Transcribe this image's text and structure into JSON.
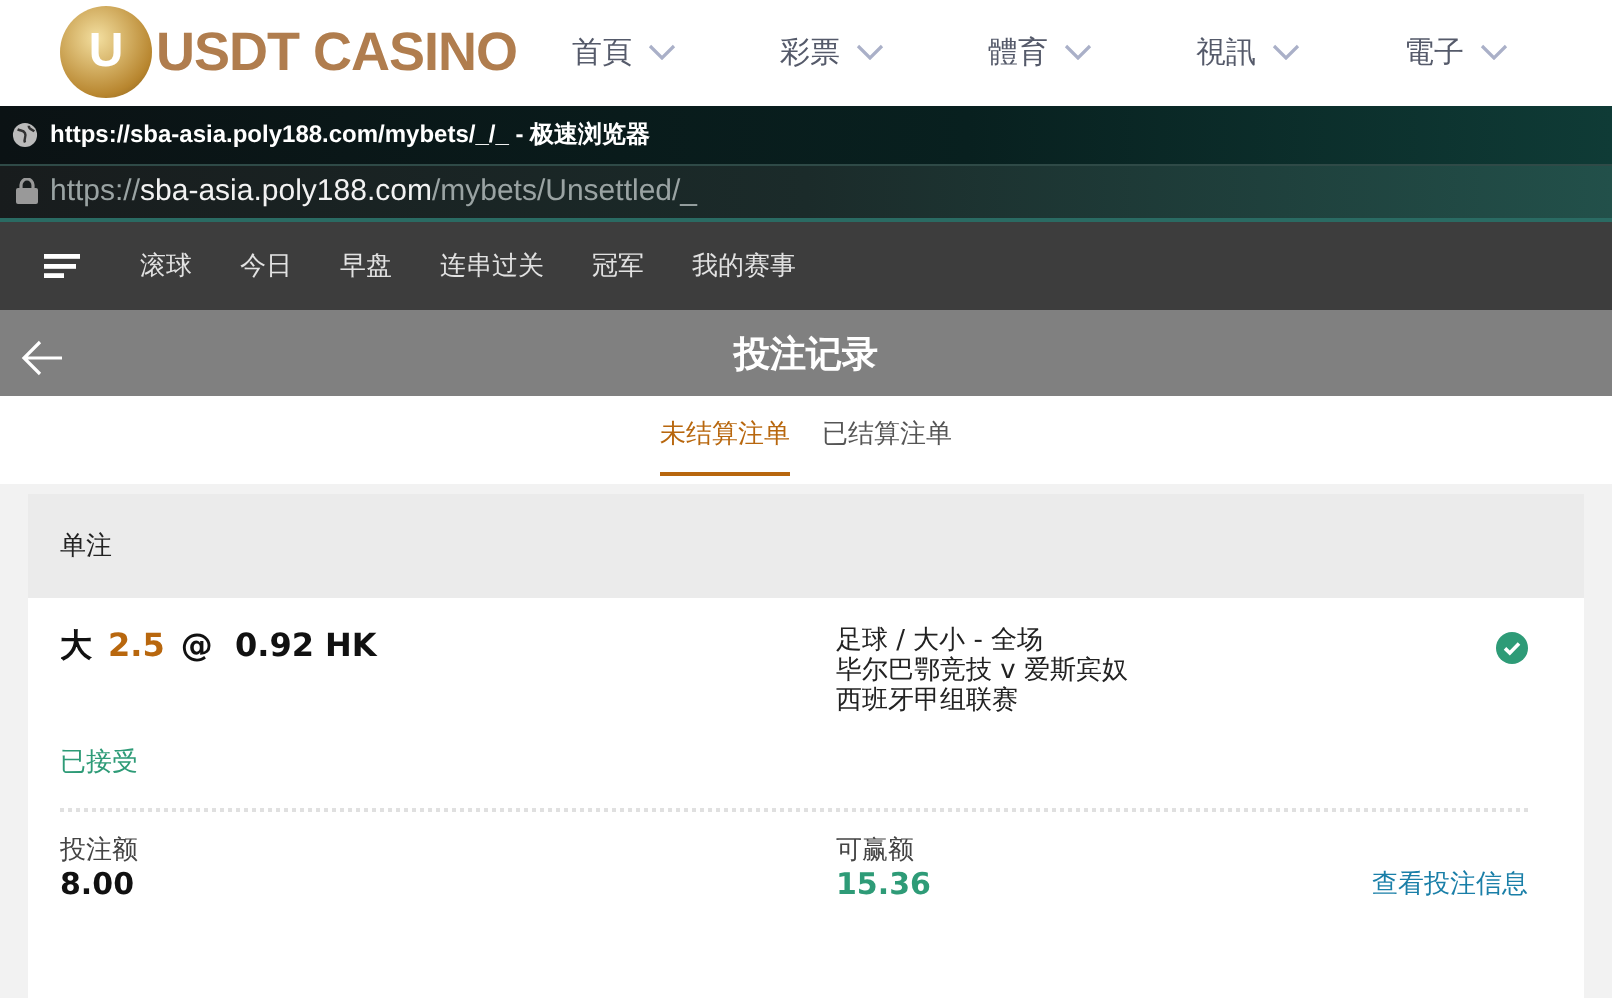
{
  "site_header": {
    "logo_mark": "U",
    "logo_text": "USDT CASINO",
    "menu": [
      {
        "label": "首頁"
      },
      {
        "label": "彩票"
      },
      {
        "label": "體育"
      },
      {
        "label": "視訊"
      },
      {
        "label": "電子"
      }
    ]
  },
  "browser": {
    "title": "https://sba-asia.poly188.com/mybets/_/_ - 极速浏览器",
    "address": {
      "scheme": "https://",
      "host": "sba-asia.poly188.com",
      "path": "/mybets/Unsettled/_"
    }
  },
  "sport_nav": {
    "items": [
      {
        "label": "滚球"
      },
      {
        "label": "今日"
      },
      {
        "label": "早盘"
      },
      {
        "label": "连串过关"
      },
      {
        "label": "冠军"
      },
      {
        "label": "我的赛事"
      }
    ]
  },
  "page_title": "投注记录",
  "tabs": [
    {
      "label": "未结算注单",
      "selected": true
    },
    {
      "label": "已结算注单",
      "selected": false
    }
  ],
  "bet_card": {
    "header": "单注",
    "selection": "大",
    "line": "2.5",
    "odds": "@  0.92 HK",
    "market": "足球 / 大小 - 全场",
    "match": "毕尔巴鄂竞技 v 爱斯宾奴",
    "league": "西班牙甲组联赛",
    "accepted": true,
    "status": "已接受",
    "stake_label": "投注额",
    "stake": "8.00",
    "win_label": "可赢额",
    "win": "15.36",
    "details_link": "查看投注信息"
  }
}
